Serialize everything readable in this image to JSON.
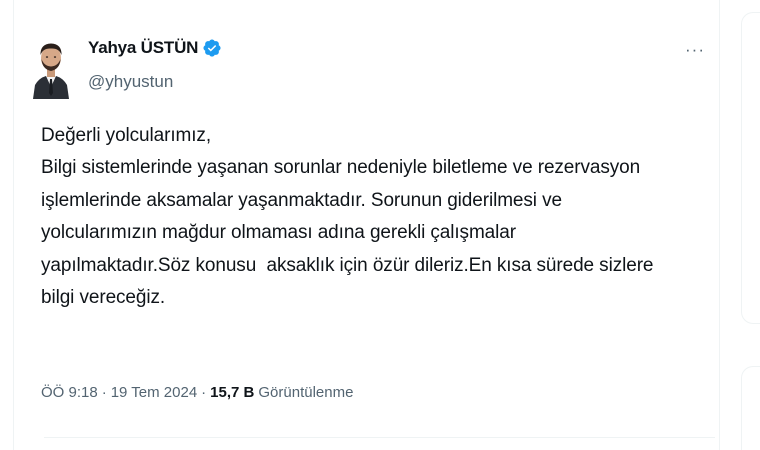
{
  "author": {
    "name": "Yahya ÜSTÜN",
    "handle": "@yhyustun",
    "verified": true,
    "avatar_icon": "avatar-portrait"
  },
  "actions": {
    "more_label": "···"
  },
  "tweet": {
    "lines": [
      "Değerli yolcularımız,",
      "Bilgi sistemlerinde yaşanan sorunlar nedeniyle biletleme ve rezervasyon",
      "işlemlerinde aksamalar yaşanmaktadır. Sorunun giderilmesi ve",
      "yolcularımızın mağdur olmaması adına gerekli çalışmalar",
      "yapılmaktadır.Söz konusu  aksaklık için özür dileriz.En kısa sürede sizlere",
      "bilgi vereceğiz."
    ]
  },
  "meta": {
    "time": "ÖÖ 9:18",
    "separator": "·",
    "date": "19 Tem 2024",
    "views_count": "15,7 B",
    "views_label": "Görüntülenme"
  },
  "colors": {
    "verified_blue": "#1d9bf0",
    "text_primary": "#0f1419",
    "text_secondary": "#536471",
    "border": "#eff3f4"
  }
}
